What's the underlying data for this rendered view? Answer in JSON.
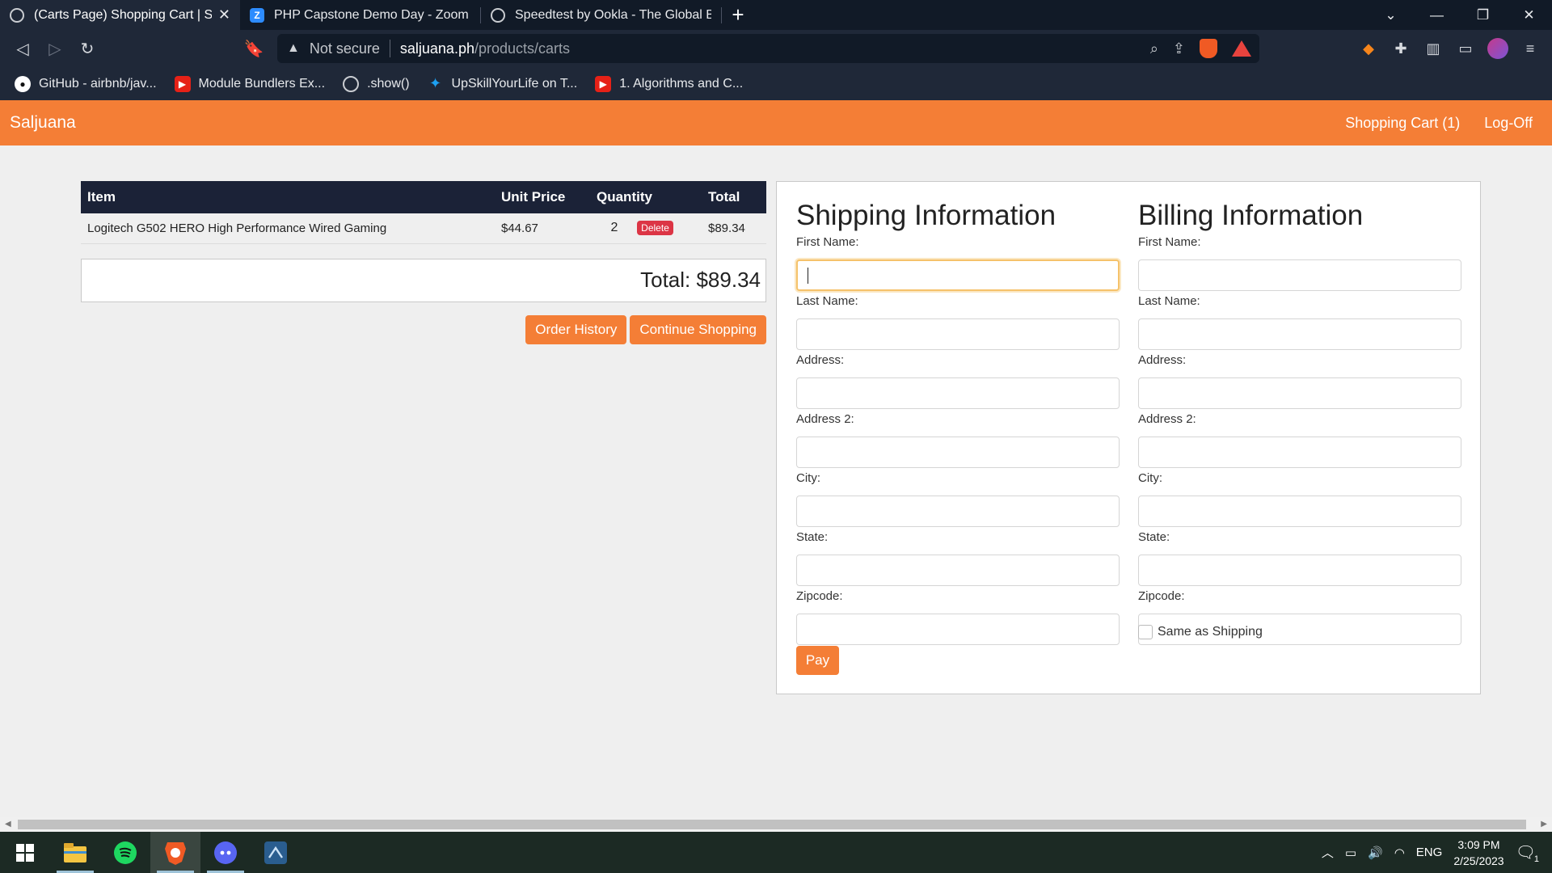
{
  "browser": {
    "tabs": [
      {
        "title": "(Carts Page) Shopping Cart | Salju",
        "active": true
      },
      {
        "title": "PHP Capstone Demo Day - Zoom",
        "active": false
      },
      {
        "title": "Speedtest by Ookla - The Global Broa",
        "active": false
      }
    ],
    "new_tab": "+",
    "address": {
      "security": "Not secure",
      "host": "saljuana.ph",
      "path": "/products/carts"
    },
    "brave_badge": "1",
    "alerts_badge": "1",
    "bookmarks": [
      {
        "label": "GitHub - airbnb/jav...",
        "icon": "github-icon"
      },
      {
        "label": "Module Bundlers Ex...",
        "icon": "youtube-icon"
      },
      {
        "label": ".show()",
        "icon": "globe-icon"
      },
      {
        "label": "UpSkillYourLife on T...",
        "icon": "twitter-icon"
      },
      {
        "label": "1. Algorithms and C...",
        "icon": "youtube-icon"
      }
    ]
  },
  "nav": {
    "brand": "Saljuana",
    "cart_link": "Shopping Cart (1)",
    "logoff": "Log-Off"
  },
  "cart": {
    "headers": [
      "Item",
      "Unit Price",
      "Quantity",
      "Total"
    ],
    "rows": [
      {
        "item": "Logitech G502 HERO High Performance Wired Gaming",
        "unit_price": "$44.67",
        "quantity": "2",
        "delete": "Delete",
        "total": "$89.34"
      }
    ],
    "grand_total": "Total: $89.34",
    "order_history": "Order History",
    "continue_shopping": "Continue Shopping"
  },
  "shipping": {
    "title": "Shipping Information",
    "labels": [
      "First Name:",
      "Last Name:",
      "Address:",
      "Address 2:",
      "City:",
      "State:",
      "Zipcode:"
    ]
  },
  "billing": {
    "title": "Billing Information",
    "labels": [
      "First Name:",
      "Last Name:",
      "Address:",
      "Address 2:",
      "City:",
      "State:",
      "Zipcode:"
    ],
    "same_as_shipping": "Same as Shipping"
  },
  "pay_label": "Pay",
  "colors": {
    "accent": "#f47e36",
    "table_header": "#1b2237",
    "delete": "#dc3545"
  },
  "taskbar": {
    "apps": [
      "windows-start-icon",
      "file-explorer-icon",
      "spotify-icon",
      "brave-browser-icon",
      "discord-icon",
      "vscode-icon"
    ],
    "language": "ENG",
    "time": "3:09 PM",
    "date": "2/25/2023",
    "notifications": "1"
  }
}
